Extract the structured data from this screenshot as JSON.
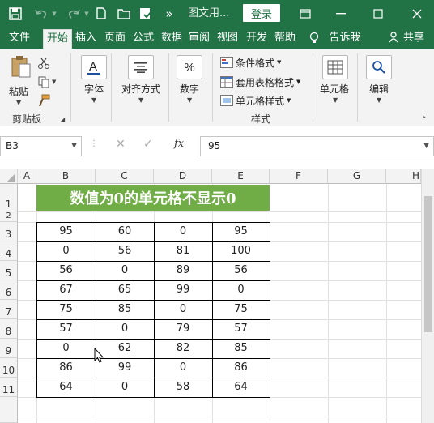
{
  "titlebar": {
    "doc_title": "图文用...",
    "login_label": "登录",
    "more_symbol": "»"
  },
  "tabs": [
    {
      "label": "文件"
    },
    {
      "label": "开始"
    },
    {
      "label": "插入"
    },
    {
      "label": "页面"
    },
    {
      "label": "公式"
    },
    {
      "label": "数据"
    },
    {
      "label": "审阅"
    },
    {
      "label": "视图"
    },
    {
      "label": "开发"
    },
    {
      "label": "帮助"
    }
  ],
  "tell_me": "告诉我",
  "share_label": "共享",
  "ribbon": {
    "paste_label": "粘贴",
    "clipboard_label": "剪贴板",
    "font_label": "字体",
    "align_label": "对齐方式",
    "number_label": "数字",
    "cond_format_label": "条件格式",
    "table_format_label": "套用表格格式",
    "cell_style_label": "单元格样式",
    "styles_label": "样式",
    "cells_label": "单元格",
    "edit_label": "编辑"
  },
  "formula_bar": {
    "name_box": "B3",
    "value": "95"
  },
  "grid": {
    "columns": [
      "A",
      "B",
      "C",
      "D",
      "E",
      "F",
      "G",
      "H"
    ],
    "rows": [
      "1",
      "2",
      "3",
      "4",
      "5",
      "6",
      "7",
      "8",
      "9",
      "10",
      "11"
    ],
    "title": "数值为0的单元格不显示0",
    "table": [
      [
        "95",
        "60",
        "0",
        "95"
      ],
      [
        "0",
        "56",
        "81",
        "100"
      ],
      [
        "56",
        "0",
        "89",
        "56"
      ],
      [
        "67",
        "65",
        "99",
        "0"
      ],
      [
        "75",
        "85",
        "0",
        "75"
      ],
      [
        "57",
        "0",
        "79",
        "57"
      ],
      [
        "0",
        "62",
        "82",
        "85"
      ],
      [
        "86",
        "99",
        "0",
        "86"
      ],
      [
        "64",
        "0",
        "58",
        "64"
      ]
    ]
  },
  "colors": {
    "excel_green": "#217346",
    "title_fill": "#70ad47"
  }
}
